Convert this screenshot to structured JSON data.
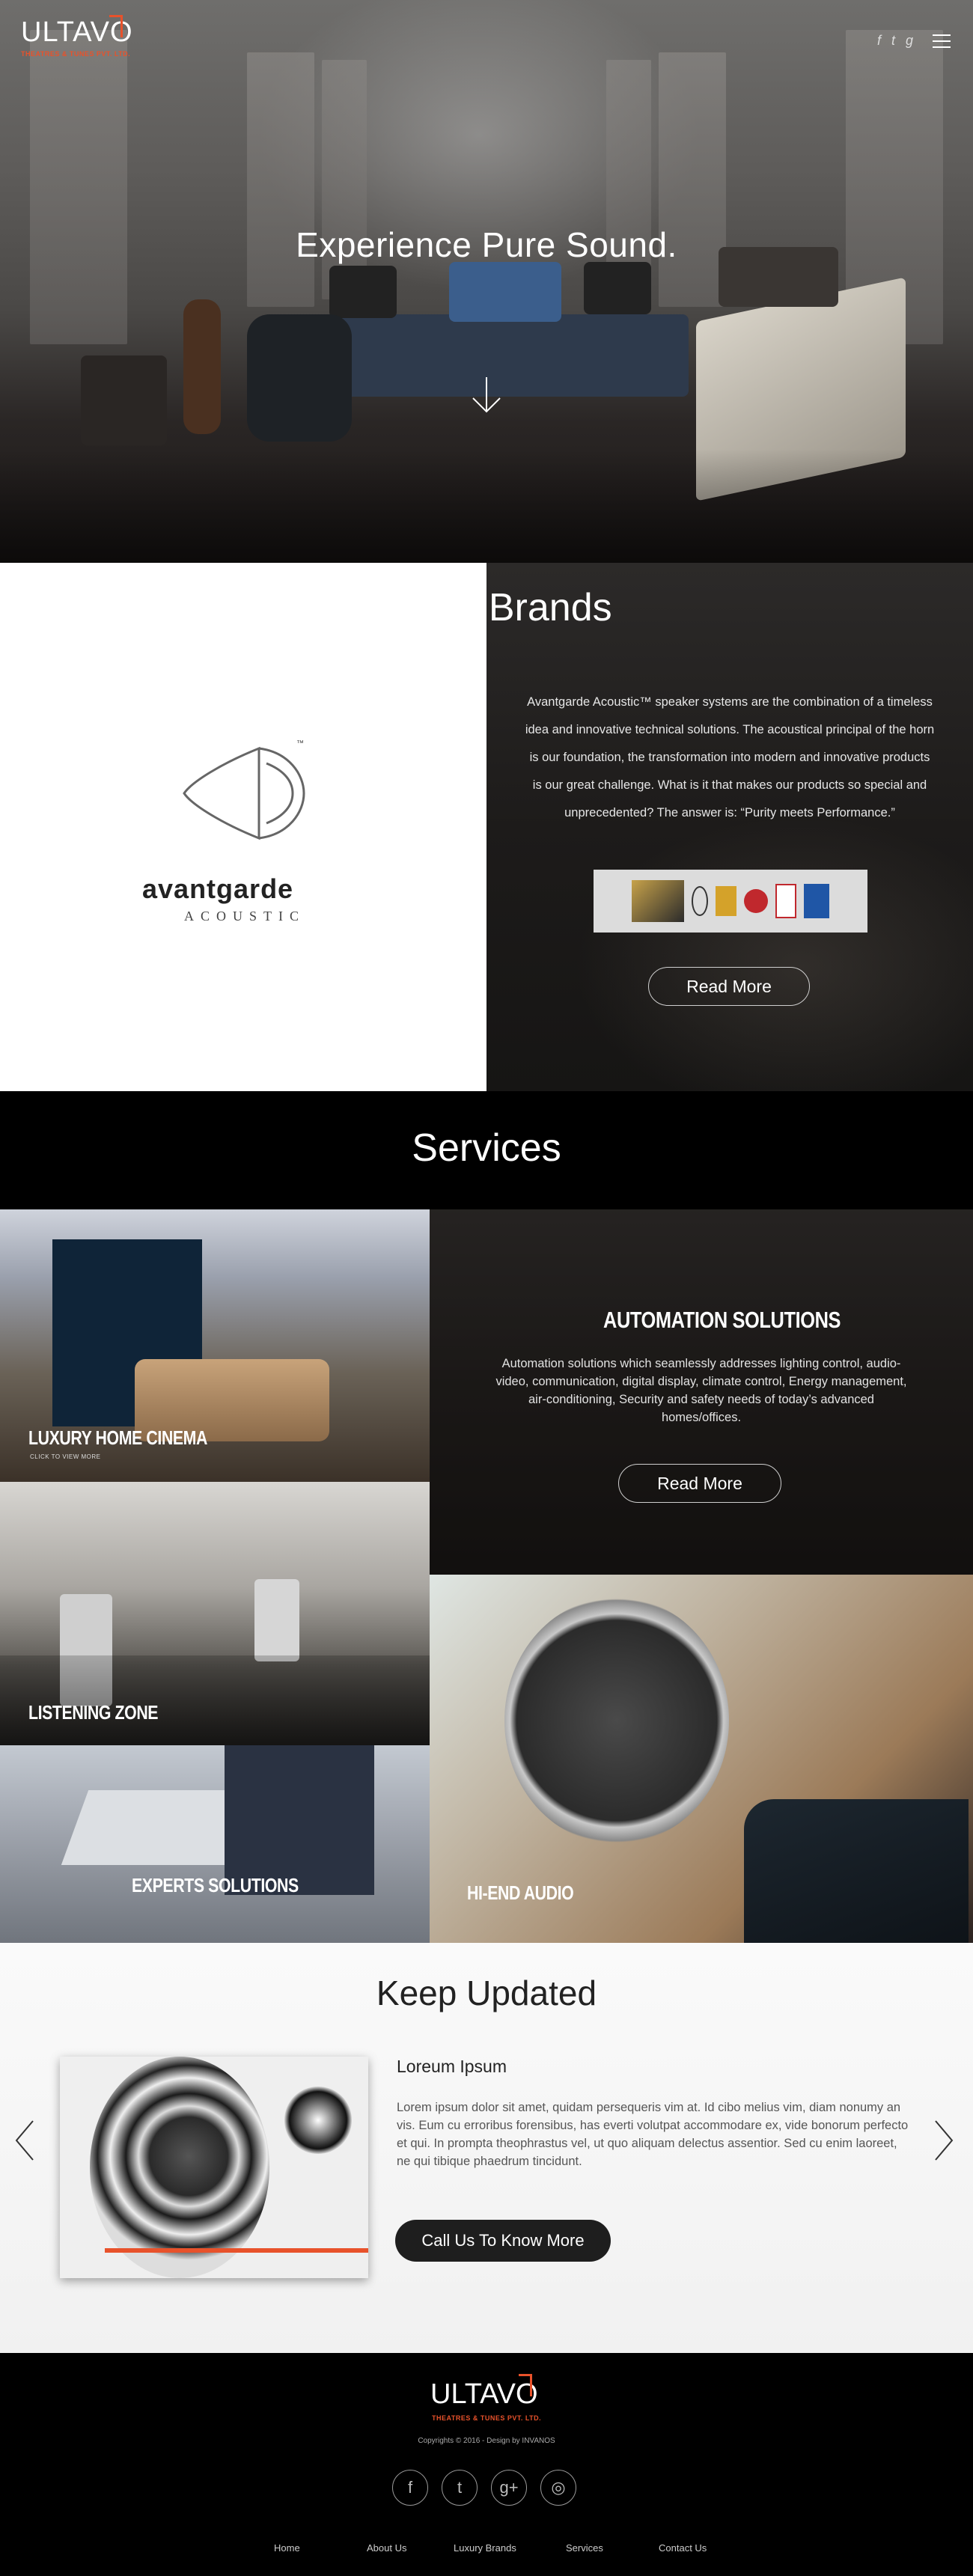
{
  "header": {
    "logo_text": "ULTAVO",
    "logo_tagline": "THEATRES & TUNES PVT. LTD.",
    "social": [
      {
        "icon": "facebook-icon",
        "glyph": "f"
      },
      {
        "icon": "twitter-icon",
        "glyph": "t"
      },
      {
        "icon": "google-plus-icon",
        "glyph": "g"
      }
    ],
    "menu_icon": "hamburger-icon"
  },
  "hero": {
    "title": "Experience Pure Sound.",
    "scroll_icon": "arrow-down-icon"
  },
  "luxury": {
    "title": "Luxury Brands",
    "brand_name": "avantgarde",
    "brand_sub": "ACOUSTIC",
    "description": "Avantgarde Acoustic™ speaker systems are the combination of a timeless idea and innovative technical solutions. The acoustical principal of the horn is our foundation, the transformation into modern and innovative products is our great challenge. What is it that makes our products so special and unprecedented? The answer is: “Purity meets Performance.”",
    "read_more": "Read More"
  },
  "services": {
    "title": "Services",
    "tiles": {
      "home_cinema": {
        "label": "LUXURY HOME CINEMA",
        "sub": "CLICK TO VIEW MORE"
      },
      "automation": {
        "label": "AUTOMATION SOLUTIONS",
        "text": "Automation solutions which seamlessly addresses lighting control, audio-video, communication, digital display, climate control, Energy management, air-conditioning, Security and safety needs of today’s advanced homes/offices.",
        "read_more": "Read More"
      },
      "listening": {
        "label": "LISTENING ZONE"
      },
      "experts": {
        "label": "EXPERTS SOLUTIONS"
      },
      "hiend": {
        "label": "HI-END AUDIO"
      }
    }
  },
  "updated": {
    "title": "Keep Updated",
    "post_title": "Loreum Ipsum",
    "post_body": "Lorem ipsum dolor sit amet, quidam persequeris vim at. Id cibo melius vim, diam nonumy an vis. Eum cu erroribus forensibus, has everti volutpat accommodare ex, vide bonorum perfecto et qui. In prompta theophrastus vel, ut quo aliquam delectus assentior. Sed cu enim laoreet, ne qui tibique phaedrum tincidunt.",
    "cta": "Call Us To Know More",
    "prev_icon": "chevron-left-icon",
    "next_icon": "chevron-right-icon"
  },
  "footer": {
    "logo_text": "ULTAVO",
    "logo_tagline": "THEATRES & TUNES PVT. LTD.",
    "copyright": "Copyrights © 2016 - Design by INVANOS",
    "social": [
      {
        "icon": "facebook-icon",
        "glyph": "f"
      },
      {
        "icon": "twitter-icon",
        "glyph": "t"
      },
      {
        "icon": "google-plus-icon",
        "glyph": "g+"
      },
      {
        "icon": "instagram-icon",
        "glyph": "◎"
      }
    ],
    "nav": [
      "Home",
      "About Us",
      "Luxury Brands",
      "Services",
      "Contact Us"
    ]
  },
  "colors": {
    "accent": "#e8522b",
    "dark": "#000000",
    "light": "#ffffff"
  }
}
